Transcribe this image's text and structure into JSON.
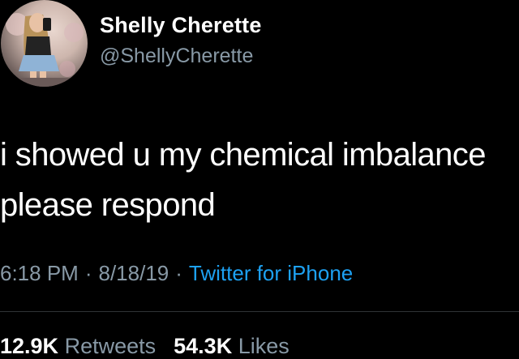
{
  "author": {
    "display_name": "Shelly Cherette",
    "handle": "@ShellyCherette",
    "avatar_icon": "profile-photo"
  },
  "tweet": {
    "lines": [
      "i showed u my chemical imbalance",
      "please respond"
    ]
  },
  "meta": {
    "time": "6:18 PM",
    "separator": "·",
    "date": "8/18/19",
    "source": "Twitter for iPhone"
  },
  "stats": {
    "retweets_count": "12.9K",
    "retweets_label": "Retweets",
    "likes_count": "54.3K",
    "likes_label": "Likes"
  },
  "colors": {
    "background": "#000000",
    "text_primary": "#ffffff",
    "text_secondary": "#8899a6",
    "link": "#1da1f2"
  }
}
